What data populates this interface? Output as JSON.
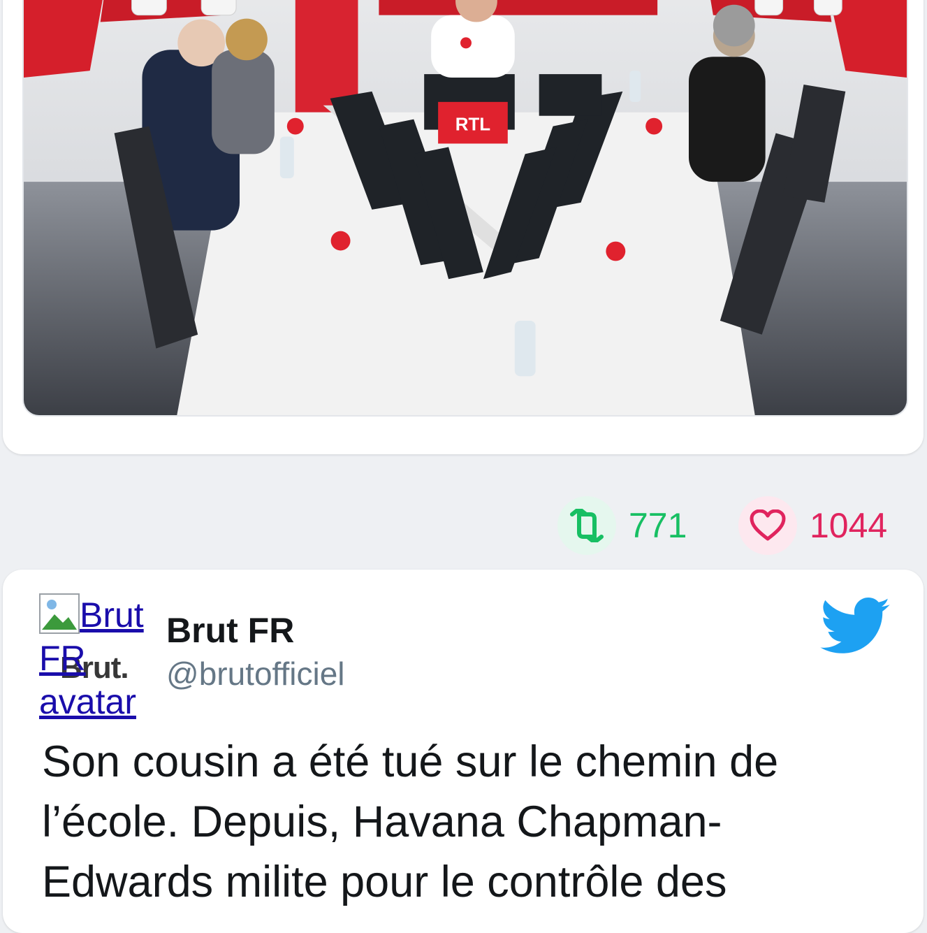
{
  "top_tweet": {
    "media": {
      "description_tags": [
        "RTL"
      ],
      "studio_sign": "RTL"
    },
    "retweets": "771",
    "likes": "1044"
  },
  "tweet": {
    "avatar_alt": "Brut FR avatar",
    "avatar_wordmark": "Brut.",
    "author_name": "Brut FR",
    "author_handle": "@brutofficiel",
    "text": "Son cousin a été tué sur le chemin de l’école. Depuis, Havana Chapman-Edwards milite pour le contrôle des"
  },
  "colors": {
    "retweet": "#17bf63",
    "like": "#e0245e",
    "twitter_blue": "#1da1f2"
  },
  "icons": [
    "retweet-icon",
    "heart-icon",
    "twitter-bird-icon",
    "broken-image-icon"
  ]
}
